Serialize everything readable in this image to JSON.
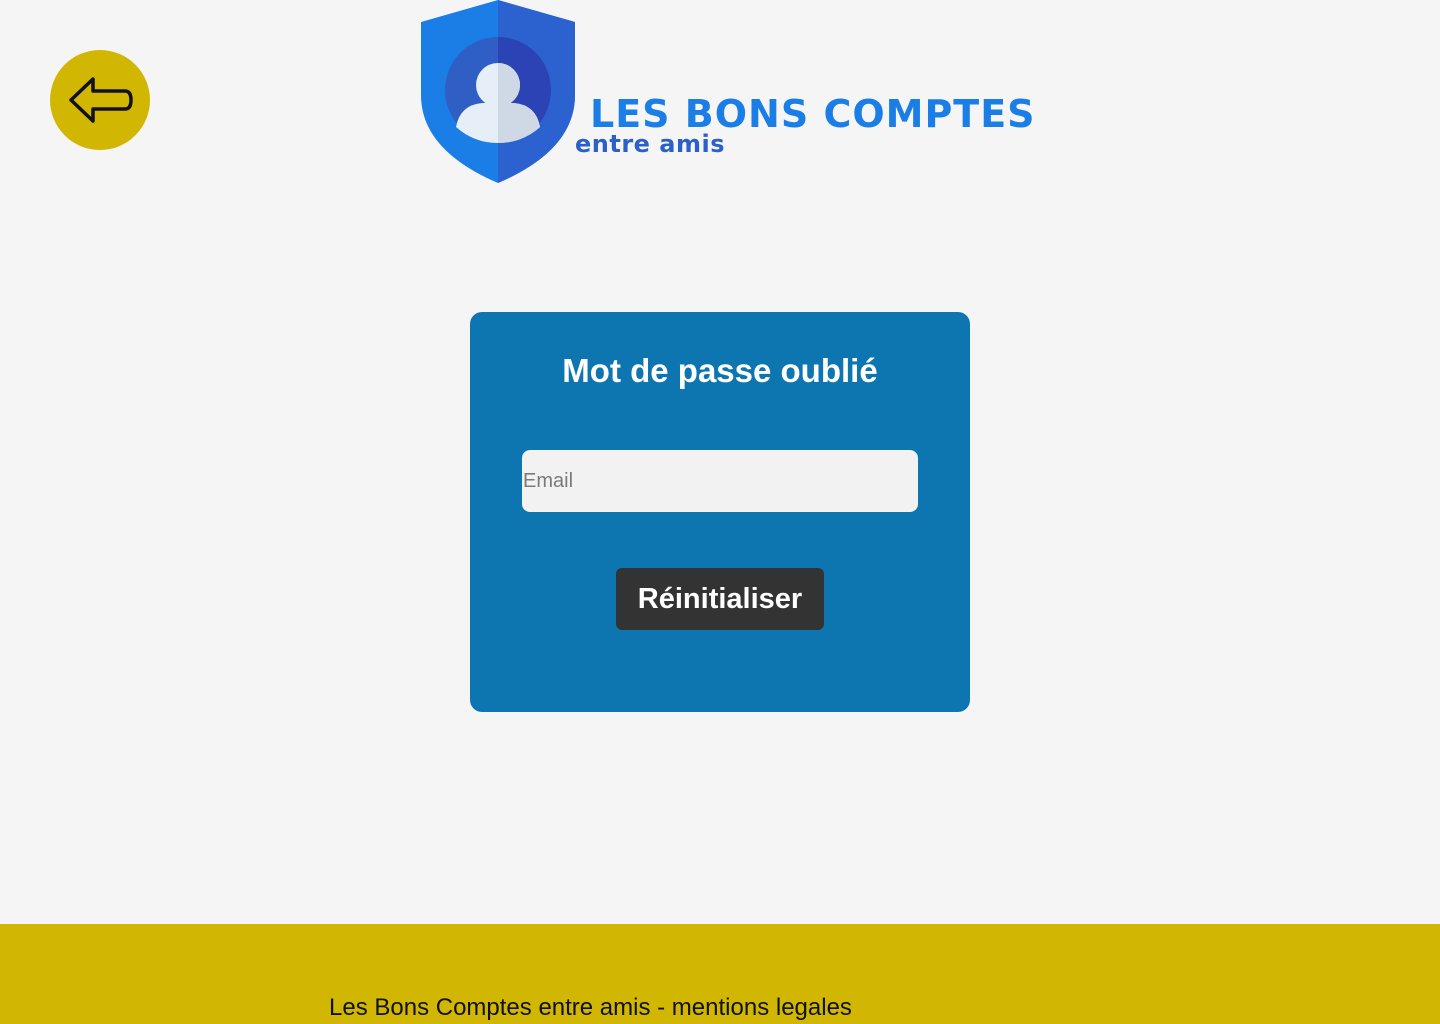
{
  "header": {
    "back_button": {
      "icon": "arrow-left-icon",
      "color": "#d1b702"
    },
    "logo": {
      "icon": "shield-user-icon",
      "title": "LES BONS COMPTES",
      "subtitle": "entre amis",
      "title_color": "#1a7ee6",
      "subtitle_color": "#2b5fc9"
    }
  },
  "form": {
    "title": "Mot de passe oublié",
    "email_placeholder": "Email",
    "email_value": "",
    "submit_label": "Réinitialiser",
    "card_color": "#0d76b0",
    "button_color": "#333333"
  },
  "footer": {
    "text": "Les Bons Comptes entre amis - mentions legales",
    "color": "#d1b702"
  }
}
